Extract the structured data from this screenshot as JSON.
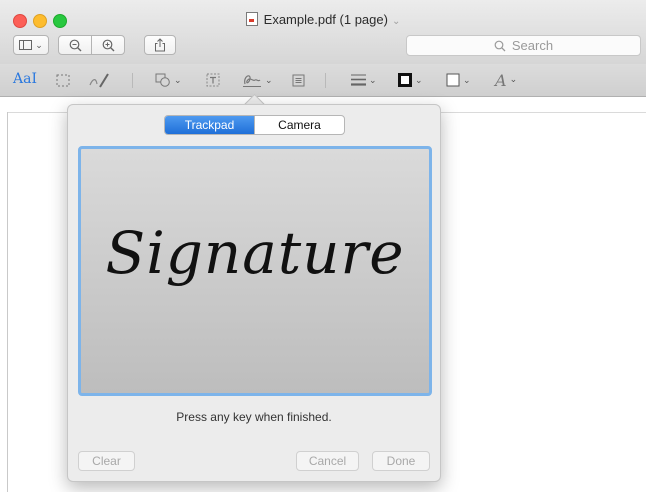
{
  "window": {
    "title": "Example.pdf (1 page)",
    "title_chevron": "⌄"
  },
  "toolbar": {
    "search_placeholder": "Search",
    "sidebar_caret": "⌄",
    "zoom_out_glyph": "−",
    "zoom_in_glyph": "+",
    "share_glyph": "⇧"
  },
  "markup": {
    "text_tool_label": "AaI",
    "font_tool_label": "A"
  },
  "signature_panel": {
    "tabs": [
      {
        "label": "Trackpad",
        "active": true
      },
      {
        "label": "Camera",
        "active": false
      }
    ],
    "signature_text": "Signature",
    "hint": "Press any key when finished.",
    "clear_label": "Clear",
    "cancel_label": "Cancel",
    "done_label": "Done"
  },
  "icons": [
    "close-icon",
    "minimize-icon",
    "zoom-icon",
    "pdf-file-icon",
    "sidebar-icon",
    "zoom-out-icon",
    "zoom-in-icon",
    "share-icon",
    "search-icon",
    "rect-select-icon",
    "sketch-icon",
    "shapes-icon",
    "text-box-icon",
    "signature-icon",
    "note-icon",
    "line-style-icon",
    "border-color-icon",
    "fill-color-icon",
    "text-style-icon"
  ],
  "colors": {
    "accent": "#2a78de",
    "pad_border": "#7db4ea",
    "close": "#fc5f57",
    "minimize": "#fdbc2e",
    "zoom": "#28c840"
  }
}
